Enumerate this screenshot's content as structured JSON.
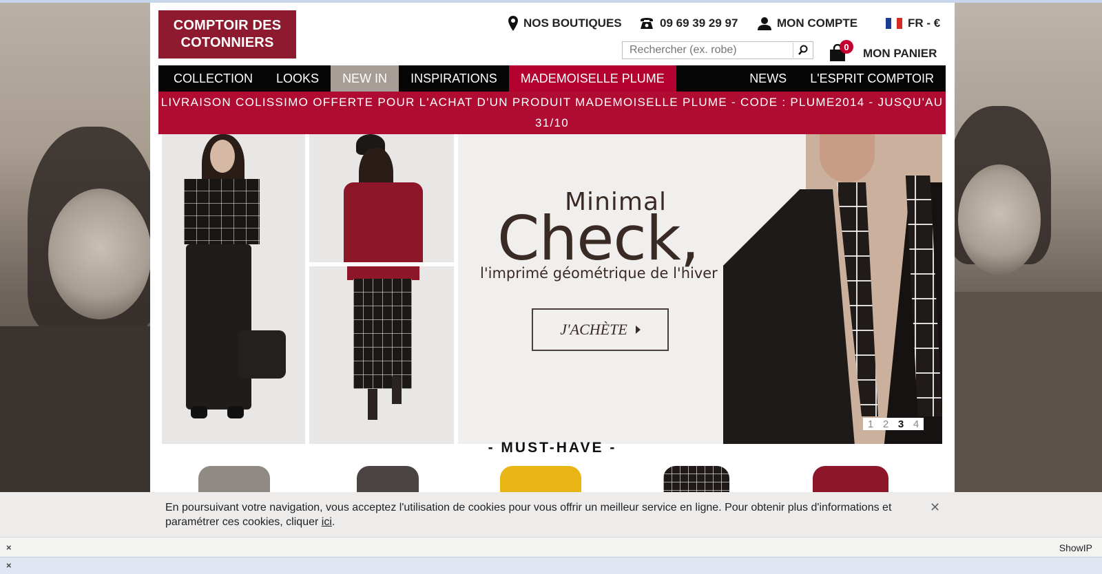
{
  "header": {
    "logo_line1": "COMPTOIR DES",
    "logo_line2": "COTONNIERS",
    "stores_label": "NOS BOUTIQUES",
    "phone": "09 69 39 29 97",
    "account_label": "MON COMPTE",
    "lang_label": "FR - €",
    "search_placeholder": "Rechercher (ex. robe)",
    "cart_count": "0",
    "cart_label": "MON PANIER"
  },
  "nav": {
    "items": [
      "COLLECTION",
      "LOOKS",
      "NEW IN",
      "INSPIRATIONS",
      "MADEMOISELLE PLUME"
    ],
    "right_items": [
      "NEWS",
      "L'ESPRIT COMPTOIR"
    ]
  },
  "promo": {
    "line1": "LIVRAISON COLISSIMO OFFERTE POUR L'ACHAT D'UN PRODUIT MADEMOISELLE PLUME - CODE : PLUME2014 - JUSQU'AU",
    "line2": "31/10"
  },
  "hero": {
    "title_small": "Minimal",
    "title_big": "Check,",
    "subtitle": "l'imprimé géométrique de l'hiver",
    "cta_label": "J'ACHÈTE",
    "slides": [
      "1",
      "2",
      "3",
      "4"
    ],
    "current_slide": "3"
  },
  "section_title": "- MUST-HAVE -",
  "colors": {
    "brand": "#8d1a2e",
    "promo_red": "#b00b31",
    "nav_black": "#050505"
  },
  "cookie": {
    "text": "En poursuivant votre navigation, vous acceptez l'utilisation de cookies pour vous offrir un meilleur service en ligne. Pour obtenir plus d'informations et paramétrer ces cookies, cliquer",
    "link": "ici",
    "end": "."
  },
  "addon_bar": {
    "close": "×",
    "label": "ShowIP"
  },
  "bottom_bar": {
    "close": "×"
  }
}
